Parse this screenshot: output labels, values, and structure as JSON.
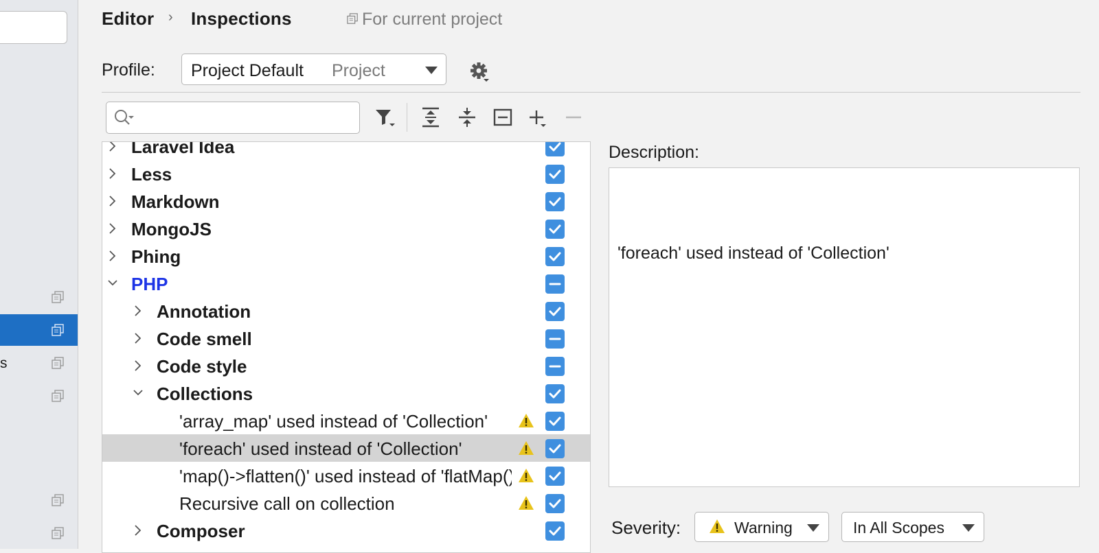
{
  "sidebar": {
    "partial_item_text": "s",
    "copy_icon_count": 6
  },
  "header": {
    "breadcrumb": [
      "Editor",
      "Inspections"
    ],
    "scope_note": "For current project"
  },
  "profile": {
    "label": "Profile:",
    "name": "Project Default",
    "type": "Project"
  },
  "toolbar": {
    "search_placeholder": "",
    "icons": [
      "filter-icon",
      "expand-all-icon",
      "collapse-all-icon",
      "reset-icon",
      "add-icon",
      "remove-icon"
    ]
  },
  "tree": {
    "rows": [
      {
        "label": "Laravel Idea",
        "state": "checked",
        "expanded": false,
        "bold": true
      },
      {
        "label": "Less",
        "state": "checked",
        "expanded": false,
        "bold": true
      },
      {
        "label": "Markdown",
        "state": "checked",
        "expanded": false,
        "bold": true
      },
      {
        "label": "MongoJS",
        "state": "checked",
        "expanded": false,
        "bold": true
      },
      {
        "label": "Phing",
        "state": "checked",
        "expanded": false,
        "bold": true
      },
      {
        "label": "PHP",
        "state": "mixed",
        "expanded": true,
        "bold": true,
        "highlight": true
      },
      {
        "label": "Annotation",
        "state": "checked",
        "expanded": false,
        "bold": true
      },
      {
        "label": "Code smell",
        "state": "mixed",
        "expanded": false,
        "bold": true
      },
      {
        "label": "Code style",
        "state": "mixed",
        "expanded": false,
        "bold": true
      },
      {
        "label": "Collections",
        "state": "checked",
        "expanded": true,
        "bold": true
      },
      {
        "label": "'array_map' used instead of 'Collection'",
        "state": "checked",
        "warning": true
      },
      {
        "label": "'foreach' used instead of 'Collection'",
        "state": "checked",
        "warning": true,
        "selected": true
      },
      {
        "label": "'map()->flatten()' used instead of 'flatMap()'",
        "state": "checked",
        "warning": true
      },
      {
        "label": "Recursive call on collection",
        "state": "checked",
        "warning": true
      },
      {
        "label": "Composer",
        "state": "checked",
        "expanded": false,
        "bold": true
      }
    ]
  },
  "description": {
    "label": "Description:",
    "text": "'foreach' used instead of 'Collection'"
  },
  "severity": {
    "label": "Severity:",
    "value": "Warning",
    "scope": "In All Scopes"
  },
  "colors": {
    "accent": "#3f8fdf",
    "selection": "#1e6fc4",
    "php_link": "#1d34e6",
    "warning": "#e8c31b"
  }
}
